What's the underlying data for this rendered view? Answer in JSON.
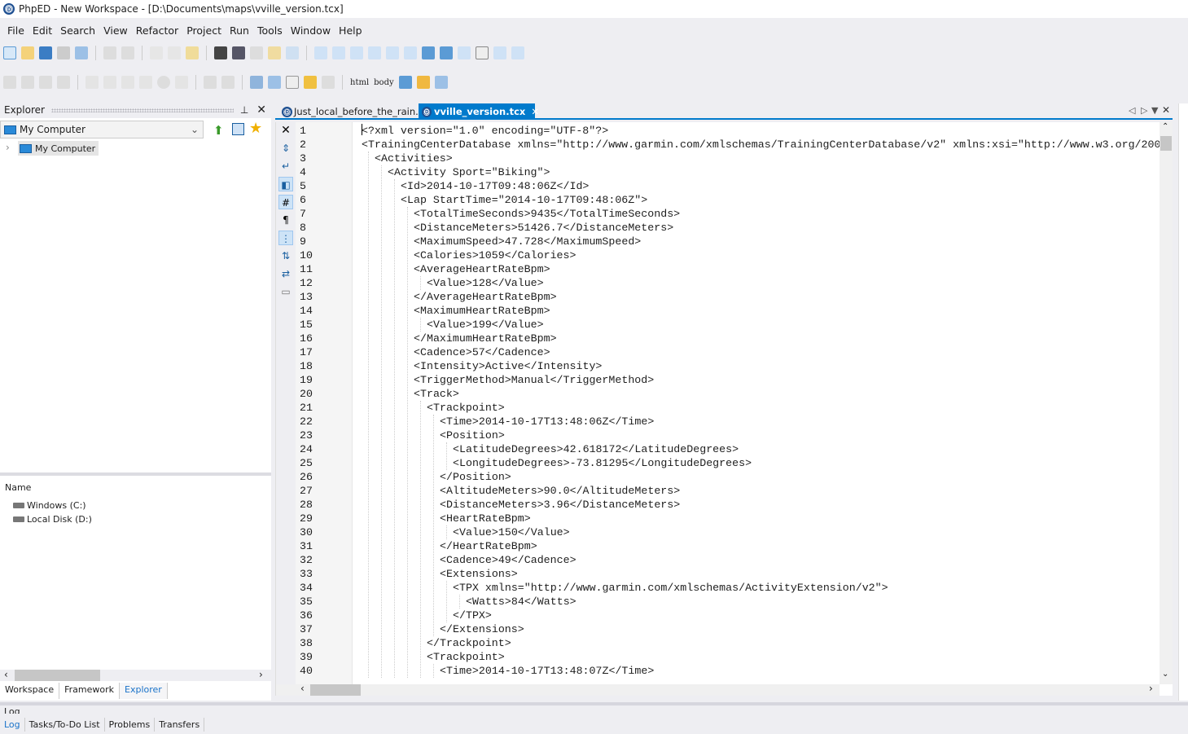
{
  "window": {
    "title": "PhpED - New Workspace - [D:\\Documents\\maps\\vville_version.tcx]"
  },
  "menu": [
    "File",
    "Edit",
    "Search",
    "View",
    "Refactor",
    "Project",
    "Run",
    "Tools",
    "Window",
    "Help"
  ],
  "toolbar": {
    "html_label": "html",
    "body_label": "body"
  },
  "explorer": {
    "title": "Explorer",
    "location": "My Computer",
    "tree_item": "My Computer",
    "name_header": "Name",
    "drives": [
      "Windows (C:)",
      "Local Disk (D:)"
    ],
    "tabs": [
      "Workspace",
      "Framework",
      "Explorer"
    ],
    "active_tab": "Explorer"
  },
  "editor": {
    "tabs": [
      "Just_local_before_the_rain.tcx",
      "vville_version.tcx"
    ],
    "active_tab": "vville_version.tcx",
    "lines": [
      [
        0,
        "<?xml version=\"1.0\" encoding=\"UTF-8\"?>"
      ],
      [
        0,
        "<TrainingCenterDatabase xmlns=\"http://www.garmin.com/xmlschemas/TrainingCenterDatabase/v2\" xmlns:xsi=\"http://www.w3.org/200"
      ],
      [
        1,
        "<Activities>"
      ],
      [
        2,
        "<Activity Sport=\"Biking\">"
      ],
      [
        3,
        "<Id>2014-10-17T09:48:06Z</Id>"
      ],
      [
        3,
        "<Lap StartTime=\"2014-10-17T09:48:06Z\">"
      ],
      [
        4,
        "<TotalTimeSeconds>9435</TotalTimeSeconds>"
      ],
      [
        4,
        "<DistanceMeters>51426.7</DistanceMeters>"
      ],
      [
        4,
        "<MaximumSpeed>47.728</MaximumSpeed>"
      ],
      [
        4,
        "<Calories>1059</Calories>"
      ],
      [
        4,
        "<AverageHeartRateBpm>"
      ],
      [
        5,
        "<Value>128</Value>"
      ],
      [
        4,
        "</AverageHeartRateBpm>"
      ],
      [
        4,
        "<MaximumHeartRateBpm>"
      ],
      [
        5,
        "<Value>199</Value>"
      ],
      [
        4,
        "</MaximumHeartRateBpm>"
      ],
      [
        4,
        "<Cadence>57</Cadence>"
      ],
      [
        4,
        "<Intensity>Active</Intensity>"
      ],
      [
        4,
        "<TriggerMethod>Manual</TriggerMethod>"
      ],
      [
        4,
        "<Track>"
      ],
      [
        5,
        "<Trackpoint>"
      ],
      [
        6,
        "<Time>2014-10-17T13:48:06Z</Time>"
      ],
      [
        6,
        "<Position>"
      ],
      [
        7,
        "<LatitudeDegrees>42.618172</LatitudeDegrees>"
      ],
      [
        7,
        "<LongitudeDegrees>-73.81295</LongitudeDegrees>"
      ],
      [
        6,
        "</Position>"
      ],
      [
        6,
        "<AltitudeMeters>90.0</AltitudeMeters>"
      ],
      [
        6,
        "<DistanceMeters>3.96</DistanceMeters>"
      ],
      [
        6,
        "<HeartRateBpm>"
      ],
      [
        7,
        "<Value>150</Value>"
      ],
      [
        6,
        "</HeartRateBpm>"
      ],
      [
        6,
        "<Cadence>49</Cadence>"
      ],
      [
        6,
        "<Extensions>"
      ],
      [
        7,
        "<TPX xmlns=\"http://www.garmin.com/xmlschemas/ActivityExtension/v2\">"
      ],
      [
        8,
        "<Watts>84</Watts>"
      ],
      [
        7,
        "</TPX>"
      ],
      [
        6,
        "</Extensions>"
      ],
      [
        5,
        "</Trackpoint>"
      ],
      [
        5,
        "<Trackpoint>"
      ],
      [
        6,
        "<Time>2014-10-17T13:48:07Z</Time>"
      ]
    ]
  },
  "bottom": {
    "title": "Log",
    "tabs": [
      "Log",
      "Tasks/To-Do List",
      "Problems",
      "Transfers"
    ],
    "active_tab": "Log"
  },
  "colors": {
    "accent": "#007acc",
    "link": "#1a73c9"
  }
}
